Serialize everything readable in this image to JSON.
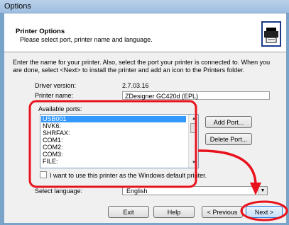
{
  "window": {
    "title": "Options"
  },
  "header": {
    "title": "Printer Options",
    "subtitle": "Please select port, printer name and language."
  },
  "intro": "Enter the name for your printer. Also, select the port your printer is connected to. When you are done, select <Next> to install the printer and add an icon to the Printers folder.",
  "driver": {
    "label": "Driver version:",
    "value": "2.7.03.16"
  },
  "printer_name": {
    "label": "Printer name:",
    "value": "ZDesigner GC420d (EPL)"
  },
  "ports": {
    "label": "Available ports:",
    "items": [
      "USB001",
      "NVK6:",
      "SHRFAX:",
      "COM1:",
      "COM2:",
      "COM3:",
      "FILE:"
    ],
    "selected": "USB001"
  },
  "buttons": {
    "add_port": "Add Port...",
    "delete_port": "Delete Port...",
    "exit": "Exit",
    "help": "Help",
    "previous": "< Previous",
    "next": "Next >"
  },
  "default_checkbox": {
    "label": "I want to use this printer as the Windows default printer.",
    "checked": false
  },
  "language": {
    "label": "Select language:",
    "value": "English"
  },
  "colors": {
    "highlight": "#3399ff",
    "annotation": "#e8121c"
  }
}
